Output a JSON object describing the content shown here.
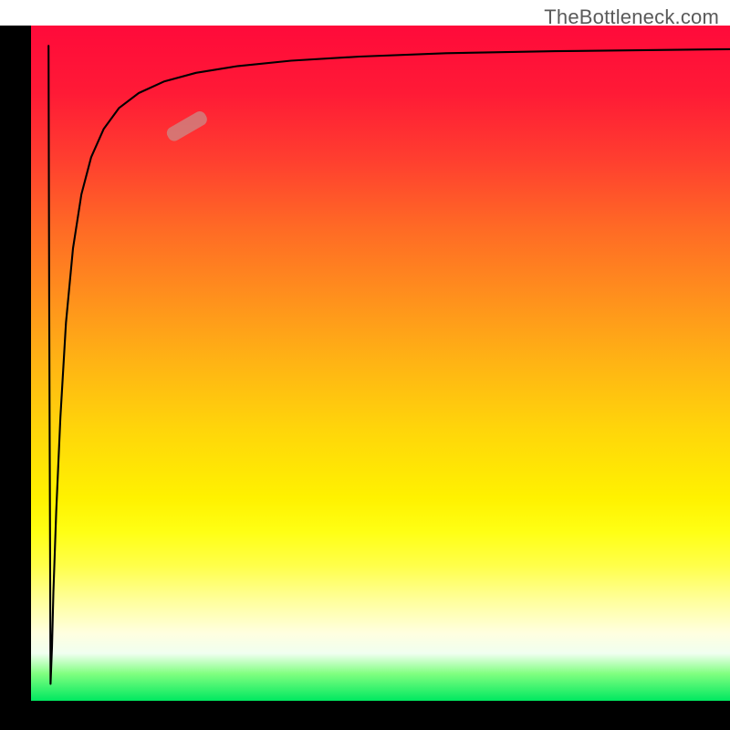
{
  "watermark": "TheBottleneck.com",
  "chart_data": {
    "type": "line",
    "title": "",
    "xlabel": "",
    "ylabel": "",
    "xlim": [
      0,
      100
    ],
    "ylim": [
      100,
      0
    ],
    "series": [
      {
        "name": "bottleneck-curve",
        "x": [
          2.8,
          3.0,
          3.2,
          3.6,
          4.2,
          5.0,
          6.0,
          7.2,
          8.6,
          10.4,
          12.6,
          15.4,
          19.0,
          23.6,
          29.6,
          37.2,
          47.0,
          59.4,
          75.0,
          100.0
        ],
        "y": [
          97.5,
          92.0,
          84.0,
          72.0,
          58.0,
          44.0,
          33.0,
          25.0,
          19.5,
          15.3,
          12.2,
          10.0,
          8.3,
          7.0,
          6.0,
          5.2,
          4.6,
          4.1,
          3.8,
          3.5
        ]
      }
    ],
    "marker": {
      "x_center": 22.3,
      "y_center": 14.9,
      "length": 6.2,
      "angle_deg": -30
    },
    "background_gradient": {
      "direction": "top-to-bottom",
      "stops": [
        {
          "offset": 0,
          "color": "#ff0a3a"
        },
        {
          "offset": 50,
          "color": "#ffb414"
        },
        {
          "offset": 75,
          "color": "#ffff14"
        },
        {
          "offset": 93,
          "color": "#f0fff0"
        },
        {
          "offset": 100,
          "color": "#00e860"
        }
      ]
    },
    "axes_visible": {
      "left": true,
      "bottom": true,
      "ticks": false,
      "labels": false
    }
  }
}
